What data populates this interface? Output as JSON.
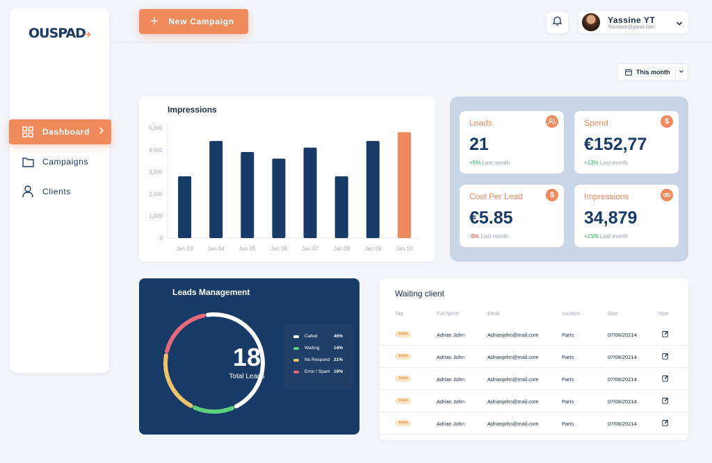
{
  "brand": {
    "name": "OUSPAD",
    "accent": "#f08a5d",
    "primary": "#173a66"
  },
  "sidebar": {
    "items": [
      {
        "label": "Dashboard",
        "icon": "grid-icon",
        "active": true
      },
      {
        "label": "Campaigns",
        "icon": "folder-icon",
        "active": false
      },
      {
        "label": "Clients",
        "icon": "user-icon",
        "active": false
      }
    ]
  },
  "header": {
    "new_campaign_label": "New Campaign",
    "user_name": "Yassine YT",
    "user_email": "Yassinetr@gmail.com"
  },
  "date_filter": {
    "label": "This month"
  },
  "impressions_chart": {
    "title": "Impressions"
  },
  "chart_data": {
    "type": "bar",
    "title": "Impressions",
    "categories": [
      "Jan 03",
      "Jan 04",
      "Jan 05",
      "Jan 06",
      "Jan 07",
      "Jan 08",
      "Jan 09",
      "Jan 10"
    ],
    "values": [
      2800,
      4400,
      3900,
      3600,
      4100,
      2800,
      4400,
      4800
    ],
    "highlight_index": 7,
    "ylim": [
      0,
      5000
    ],
    "yticks": [
      "5,000",
      "4,000",
      "3,000",
      "2,000",
      "1,000",
      "0"
    ],
    "bar_color": "#173a66",
    "highlight_color": "#f08a5d",
    "grid": false
  },
  "stats": [
    {
      "label": "Leads",
      "value": "21",
      "delta": "+5%",
      "delta_type": "pos",
      "period": "Last month",
      "icon": "users-icon"
    },
    {
      "label": "Spend",
      "value": "€152,77",
      "delta": "+13%",
      "delta_type": "pos",
      "period": "Last month",
      "icon": "dollar-icon"
    },
    {
      "label": "Cost Per Lead",
      "value": "€5.85",
      "delta": "-9%",
      "delta_type": "neg",
      "period": "Last month",
      "icon": "dollar-icon"
    },
    {
      "label": "Impressions",
      "value": "34,879",
      "delta": "+15%",
      "delta_type": "pos",
      "period": "Last month",
      "icon": "eye-icon"
    }
  ],
  "leads_management": {
    "title": "Leads Management",
    "total": "18",
    "total_label": "Total Leads",
    "segments": [
      {
        "name": "Called",
        "pct": "46%",
        "value": 46,
        "color": "#ffffff"
      },
      {
        "name": "Waiting",
        "pct": "14%",
        "value": 14,
        "color": "#5ad17a"
      },
      {
        "name": "No Respond",
        "pct": "21%",
        "value": 21,
        "color": "#f2c46a"
      },
      {
        "name": "Error / Spam",
        "pct": "19%",
        "value": 19,
        "color": "#e8697a"
      }
    ]
  },
  "waiting_clients": {
    "title": "Waiting client",
    "columns": [
      "Tag",
      "Full Name",
      "Email",
      "Location",
      "Date",
      "Note"
    ],
    "rows": [
      {
        "tag": "Await",
        "name": "Adrian John",
        "email": "Adrianjohn@mail.com",
        "location": "Paris",
        "date": "07/08/20214"
      },
      {
        "tag": "Await",
        "name": "Adrian John",
        "email": "Adrianjohn@mail.com",
        "location": "Paris",
        "date": "07/08/20214"
      },
      {
        "tag": "Await",
        "name": "Adrian John",
        "email": "Adrianjohn@mail.com",
        "location": "Paris",
        "date": "07/08/20214"
      },
      {
        "tag": "Await",
        "name": "Adrian John",
        "email": "Adrianjohn@mail.com",
        "location": "Paris",
        "date": "07/08/20214"
      },
      {
        "tag": "Await",
        "name": "Adrian John",
        "email": "Adrianjohn@mail.com",
        "location": "Paris",
        "date": "07/08/20214"
      }
    ]
  }
}
